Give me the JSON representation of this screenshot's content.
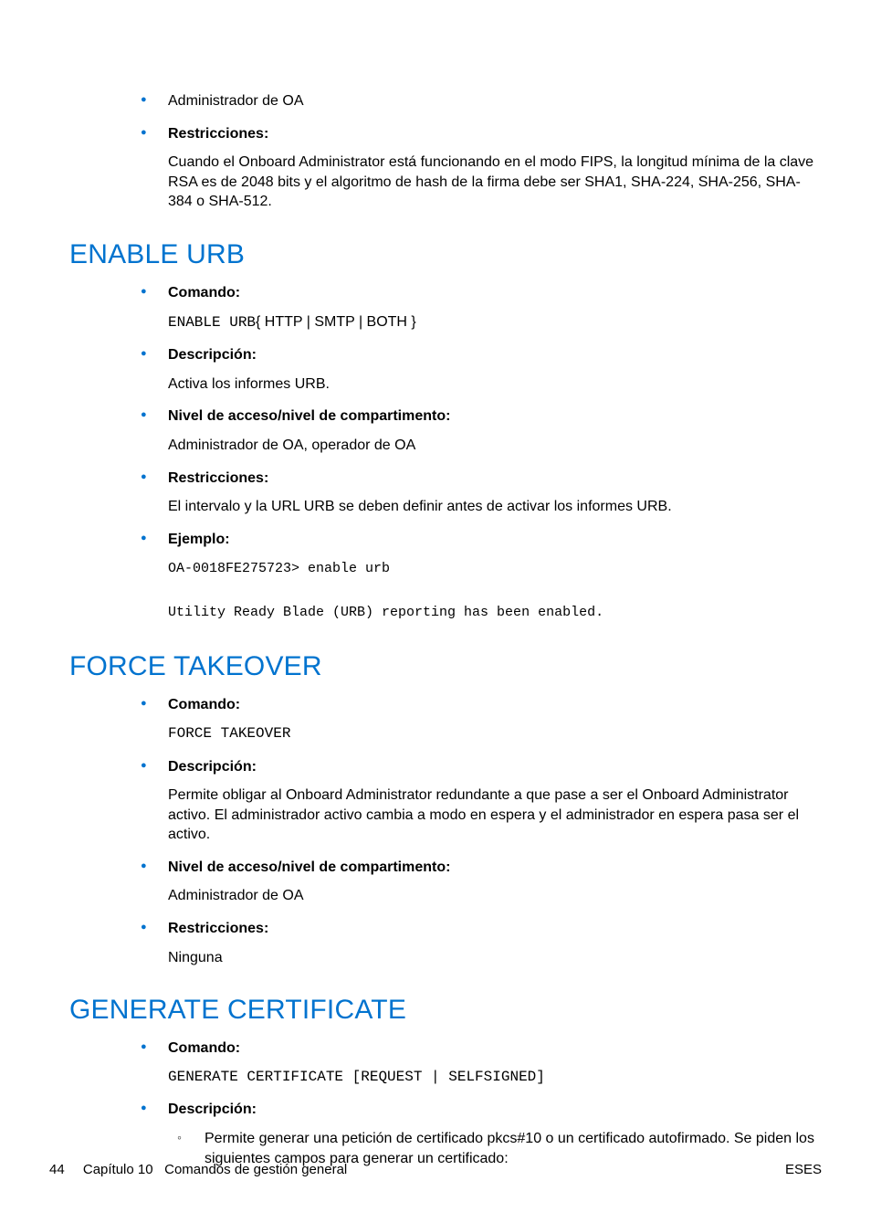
{
  "intro": {
    "text0": "Administrador de OA",
    "restr_label": "Restricciones:",
    "restr_body": "Cuando el Onboard Administrator está funcionando en el modo FIPS, la longitud mínima de la clave RSA es de 2048 bits y el algoritmo de hash de la firma debe ser SHA1, SHA-224, SHA-256, SHA-384 o SHA-512."
  },
  "sec1": {
    "heading": "ENABLE URB",
    "cmd_label": "Comando:",
    "cmd_code": "ENABLE URB",
    "cmd_tail": "{ HTTP | SMTP | BOTH }",
    "desc_label": "Descripción:",
    "desc_body": "Activa los informes URB.",
    "acc_label": "Nivel de acceso/nivel de compartimento:",
    "acc_body": "Administrador de OA, operador de OA",
    "restr_label": "Restricciones:",
    "restr_body": "El intervalo y la URL URB se deben definir antes de activar los informes URB.",
    "ex_label": "Ejemplo:",
    "ex_code": "OA-0018FE275723> enable urb\n\nUtility Ready Blade (URB) reporting has been enabled."
  },
  "sec2": {
    "heading": "FORCE TAKEOVER",
    "cmd_label": "Comando:",
    "cmd_code": "FORCE TAKEOVER",
    "desc_label": "Descripción:",
    "desc_body": "Permite obligar al Onboard Administrator redundante a que pase a ser el Onboard Administrator activo. El administrador activo cambia a modo en espera y el administrador en espera pasa ser el activo.",
    "acc_label": "Nivel de acceso/nivel de compartimento:",
    "acc_body": "Administrador de OA",
    "restr_label": "Restricciones:",
    "restr_body": "Ninguna"
  },
  "sec3": {
    "heading": "GENERATE CERTIFICATE",
    "cmd_label": "Comando:",
    "cmd_code": "GENERATE CERTIFICATE [REQUEST | SELFSIGNED]",
    "desc_label": "Descripción:",
    "desc_sub0": "Permite generar una petición de certificado pkcs#10 o un certificado autofirmado. Se piden los siguientes campos para generar un certificado:"
  },
  "footer": {
    "page_num": "44",
    "chapter": "Capítulo 10",
    "chap_title": "Comandos de gestión general",
    "lang": "ESES"
  }
}
